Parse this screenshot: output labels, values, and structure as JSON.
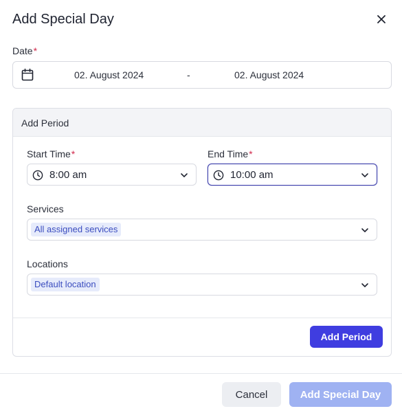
{
  "dialog": {
    "title": "Add Special Day",
    "close_icon": "close-icon"
  },
  "date": {
    "label": "Date",
    "required_mark": "*",
    "icon": "calendar-icon",
    "start": "02. August 2024",
    "separator": "-",
    "end": "02. August 2024"
  },
  "period": {
    "header": "Add Period",
    "start_time": {
      "label": "Start Time",
      "required_mark": "*",
      "icon": "clock-icon",
      "value": "8:00 am"
    },
    "end_time": {
      "label": "End Time",
      "required_mark": "*",
      "icon": "clock-icon",
      "value": "10:00 am"
    },
    "services": {
      "label": "Services",
      "selected": "All assigned services"
    },
    "locations": {
      "label": "Locations",
      "selected": "Default location"
    },
    "add_button": "Add Period"
  },
  "footer": {
    "cancel_label": "Cancel",
    "submit_label": "Add Special Day"
  },
  "colors": {
    "primary": "#3f3de0",
    "primary_disabled": "#9fb2f2",
    "required": "#d12a4c",
    "tag_bg": "#e6ebfb",
    "tag_text": "#3b4dbf"
  }
}
